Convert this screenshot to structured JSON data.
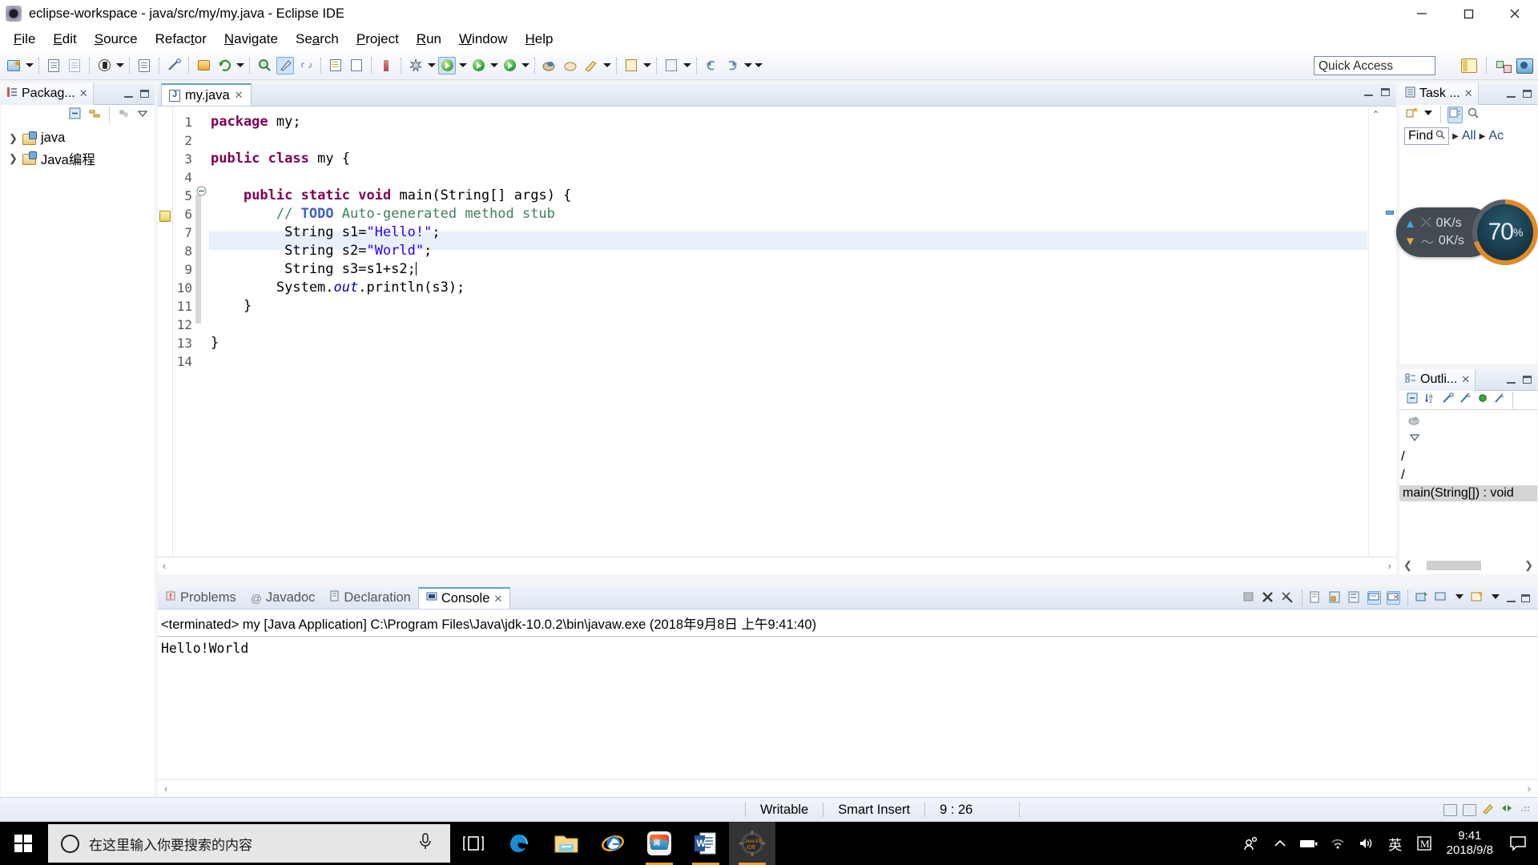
{
  "window": {
    "title": "eclipse-workspace - java/src/my/my.java - Eclipse IDE",
    "icon": "eclipse-icon",
    "minimize": "minimize-button",
    "maximize": "maximize-button",
    "close": "close-button"
  },
  "menubar": {
    "items": [
      {
        "label": "File",
        "mnemonic": "F"
      },
      {
        "label": "Edit",
        "mnemonic": "E"
      },
      {
        "label": "Source",
        "mnemonic": "S"
      },
      {
        "label": "Refactor",
        "mnemonic": "t"
      },
      {
        "label": "Navigate",
        "mnemonic": "N"
      },
      {
        "label": "Search",
        "mnemonic": "a"
      },
      {
        "label": "Project",
        "mnemonic": "P"
      },
      {
        "label": "Run",
        "mnemonic": "R"
      },
      {
        "label": "Window",
        "mnemonic": "W"
      },
      {
        "label": "Help",
        "mnemonic": "H"
      }
    ]
  },
  "quick_access": {
    "placeholder": "Quick Access",
    "label": "Quick Access"
  },
  "package_explorer": {
    "tab_label": "Packag...",
    "projects": [
      {
        "name": "java"
      },
      {
        "name": "Java编程"
      }
    ]
  },
  "editor": {
    "tab_label": "my.java",
    "lines": [
      {
        "n": "1",
        "text": "package my;"
      },
      {
        "n": "2",
        "text": ""
      },
      {
        "n": "3",
        "text": "public class my {"
      },
      {
        "n": "4",
        "text": ""
      },
      {
        "n": "5",
        "text": "    public static void main(String[] args) {"
      },
      {
        "n": "6",
        "text": "        // TODO Auto-generated method stub"
      },
      {
        "n": "7",
        "text": "         String s1=\"Hello!\";"
      },
      {
        "n": "8",
        "text": "         String s2=\"World\";"
      },
      {
        "n": "9",
        "text": "         String s3=s1+s2;"
      },
      {
        "n": "10",
        "text": "        System.out.println(s3);"
      },
      {
        "n": "11",
        "text": "    }"
      },
      {
        "n": "12",
        "text": ""
      },
      {
        "n": "13",
        "text": "}"
      },
      {
        "n": "14",
        "text": ""
      }
    ]
  },
  "task_list": {
    "tab_label": "Task ...",
    "find_label": "Find",
    "filter_all": "All",
    "filter_activate": "Ac"
  },
  "outline": {
    "tab_label": "Outli...",
    "selected_item": "main(String[]) : void"
  },
  "performance_widget": {
    "upload": "0K/s",
    "download": "0K/s",
    "cpu_percent": "70",
    "percent_symbol": "%"
  },
  "console": {
    "tabs": [
      {
        "label": "Problems",
        "icon": "problems-icon",
        "active": false
      },
      {
        "label": "Javadoc",
        "icon": "javadoc-icon",
        "active": false
      },
      {
        "label": "Declaration",
        "icon": "declaration-icon",
        "active": false
      },
      {
        "label": "Console",
        "icon": "console-icon",
        "active": true
      }
    ],
    "header": "<terminated> my [Java Application] C:\\Program Files\\Java\\jdk-10.0.2\\bin\\javaw.exe (2018年9月8日 上午9:41:40)",
    "output": "Hello!World"
  },
  "statusbar": {
    "writable": "Writable",
    "insert_mode": "Smart Insert",
    "position": "9 : 26"
  },
  "taskbar": {
    "search_placeholder": "在这里输入你要搜索的内容",
    "apps": [
      {
        "name": "microsoft-edge",
        "running": false
      },
      {
        "name": "file-explorer",
        "running": false
      },
      {
        "name": "internet-explorer",
        "running": false
      },
      {
        "name": "chinese-app",
        "running": true
      },
      {
        "name": "microsoft-word",
        "running": true
      },
      {
        "name": "eclipse-ide",
        "running": true,
        "active": true
      }
    ],
    "tray": {
      "ime_label": "英",
      "m_label": "M",
      "time": "9:41",
      "date": "2018/9/8"
    }
  },
  "colors": {
    "accent": "#6a9fd0",
    "keyword": "#7f0055",
    "string": "#2a00ff",
    "comment": "#3f7f5f",
    "todo": "#3f5fbf",
    "gauge": "#e08a2a",
    "taskbar_bg": "#000000"
  }
}
